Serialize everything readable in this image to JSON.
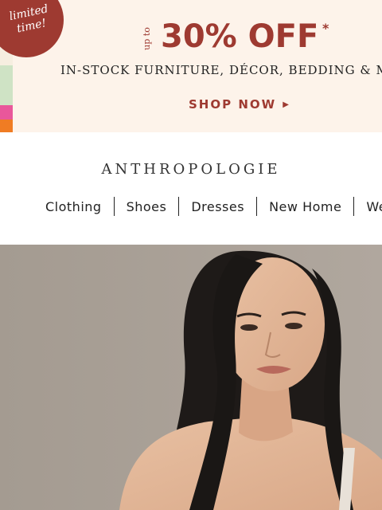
{
  "promo": {
    "badge_text": "limited time!",
    "up_to": "up to",
    "headline": "30% OFF",
    "asterisk": "*",
    "subline": "IN-STOCK FURNITURE, DÉCOR, BEDDING & M",
    "cta": "SHOP NOW",
    "cta_icon": "triangle-right-icon"
  },
  "brand": {
    "logo": "ANTHROPOLOGIE"
  },
  "nav": {
    "items": [
      {
        "label": "Clothing"
      },
      {
        "label": "Shoes"
      },
      {
        "label": "Dresses"
      },
      {
        "label": "New Home"
      },
      {
        "label": "We"
      }
    ]
  },
  "colors": {
    "accent": "#9e3a31",
    "banner_bg": "#fdf3ea",
    "hero_bg": "#a9a097"
  }
}
